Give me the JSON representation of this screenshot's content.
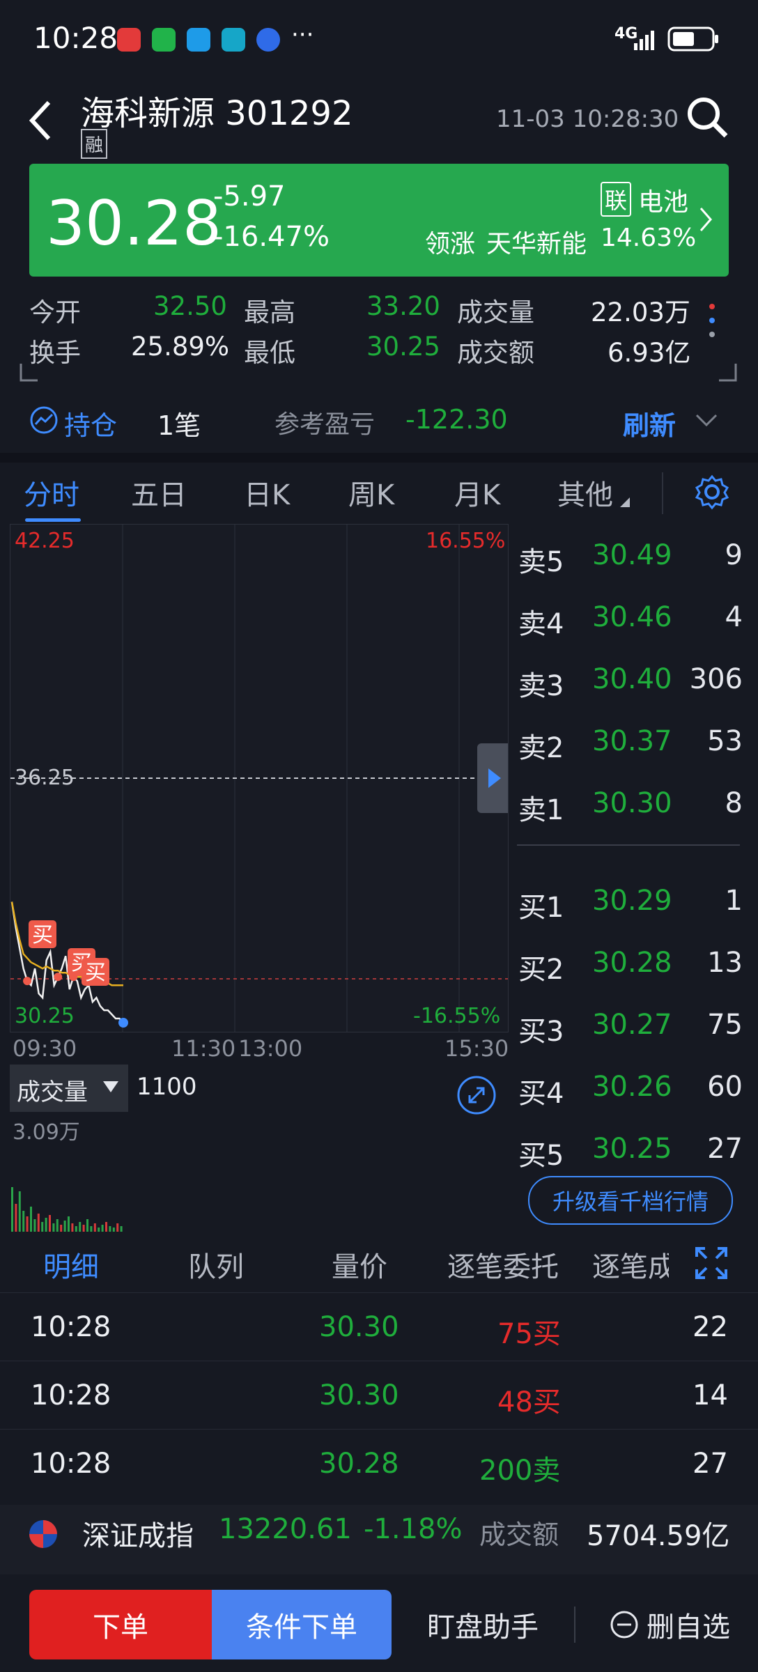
{
  "status": {
    "time": "10:28",
    "more": "···",
    "network": "4G",
    "colors": {
      "a": "#e33a3a",
      "b": "#21b34a",
      "c": "#1e9be8",
      "d": "#16a6c8",
      "e": "#2f6be8"
    }
  },
  "header": {
    "title": "海科新源 301292",
    "badge": "融",
    "datetime": "11-03 10:28:30"
  },
  "quote": {
    "price": "30.28",
    "change": "-5.97",
    "change_pct": "-16.47%",
    "sector_badge": "联",
    "sector": "电池",
    "lead_label": "领涨",
    "lead_name": "天华新能",
    "lead_pct": "14.63%"
  },
  "stats": {
    "open_label": "今开",
    "open": "32.50",
    "high_label": "最高",
    "high": "33.20",
    "volume_label": "成交量",
    "volume": "22.03万",
    "turnover_label": "换手",
    "turnover": "25.89%",
    "low_label": "最低",
    "low": "30.25",
    "amount_label": "成交额",
    "amount": "6.93亿"
  },
  "position": {
    "label": "持仓",
    "count": "1笔",
    "pl_label": "参考盈亏",
    "pl": "-122.30",
    "refresh": "刷新"
  },
  "tabs": [
    "分时",
    "五日",
    "日K",
    "周K",
    "月K",
    "其他"
  ],
  "chart_data": {
    "type": "line",
    "y_top": "42.25",
    "y_mid": "36.25",
    "y_bottom": "30.25",
    "pct_top": "16.55%",
    "pct_bottom": "-16.55%",
    "x_labels": [
      "09:30",
      "11:30",
      "13:00",
      "15:30"
    ],
    "ylim": [
      30.25,
      42.25
    ],
    "series": [
      {
        "values": [
          33.2,
          32.6,
          32.1,
          31.6,
          31.3,
          31.2,
          31.6,
          31.0,
          30.9,
          31.8,
          32.0,
          31.2,
          31.4,
          31.6,
          31.9,
          31.1,
          31.4,
          31.3,
          30.9,
          31.1,
          31.2,
          30.8,
          30.9,
          30.7,
          30.6,
          30.6,
          30.5,
          30.4,
          30.4,
          30.3
        ]
      },
      {
        "values": [
          33.2,
          32.7,
          32.3,
          31.95,
          31.85,
          31.75,
          31.7,
          31.65,
          31.6,
          31.65,
          31.6,
          31.55,
          31.55,
          31.5,
          31.5,
          31.45,
          31.45,
          31.4,
          31.4,
          31.35,
          31.35,
          31.3,
          31.3,
          31.3,
          31.25,
          31.25,
          31.2,
          31.2,
          31.2,
          31.2
        ]
      }
    ],
    "trade_marks": [
      "买",
      "买",
      "买"
    ]
  },
  "volume": {
    "label": "成交量",
    "value": "1100",
    "max": "3.09万"
  },
  "orderbook": {
    "asks": [
      {
        "label": "卖5",
        "price": "30.49",
        "qty": "9"
      },
      {
        "label": "卖4",
        "price": "30.46",
        "qty": "4"
      },
      {
        "label": "卖3",
        "price": "30.40",
        "qty": "306"
      },
      {
        "label": "卖2",
        "price": "30.37",
        "qty": "53"
      },
      {
        "label": "卖1",
        "price": "30.30",
        "qty": "8"
      }
    ],
    "bids": [
      {
        "label": "买1",
        "price": "30.29",
        "qty": "1"
      },
      {
        "label": "买2",
        "price": "30.28",
        "qty": "13"
      },
      {
        "label": "买3",
        "price": "30.27",
        "qty": "75"
      },
      {
        "label": "买4",
        "price": "30.26",
        "qty": "60"
      },
      {
        "label": "买5",
        "price": "30.25",
        "qty": "27"
      }
    ],
    "upgrade": "升级看千档行情"
  },
  "detail_tabs": [
    "明细",
    "队列",
    "量价",
    "逐笔委托",
    "逐笔成"
  ],
  "trades": [
    {
      "time": "10:28",
      "price": "30.30",
      "vol": "75买",
      "n": "22",
      "side": "buy"
    },
    {
      "time": "10:28",
      "price": "30.30",
      "vol": "48买",
      "n": "14",
      "side": "buy"
    },
    {
      "time": "10:28",
      "price": "30.28",
      "vol": "200卖",
      "n": "27",
      "side": "sell"
    }
  ],
  "index": {
    "name": "深证成指",
    "value": "13220.61",
    "pct": "-1.18%",
    "amount_label": "成交额",
    "amount": "5704.59亿"
  },
  "bottom": {
    "order": "下单",
    "cond_order": "条件下单",
    "assistant": "盯盘助手",
    "remove": "删自选"
  }
}
